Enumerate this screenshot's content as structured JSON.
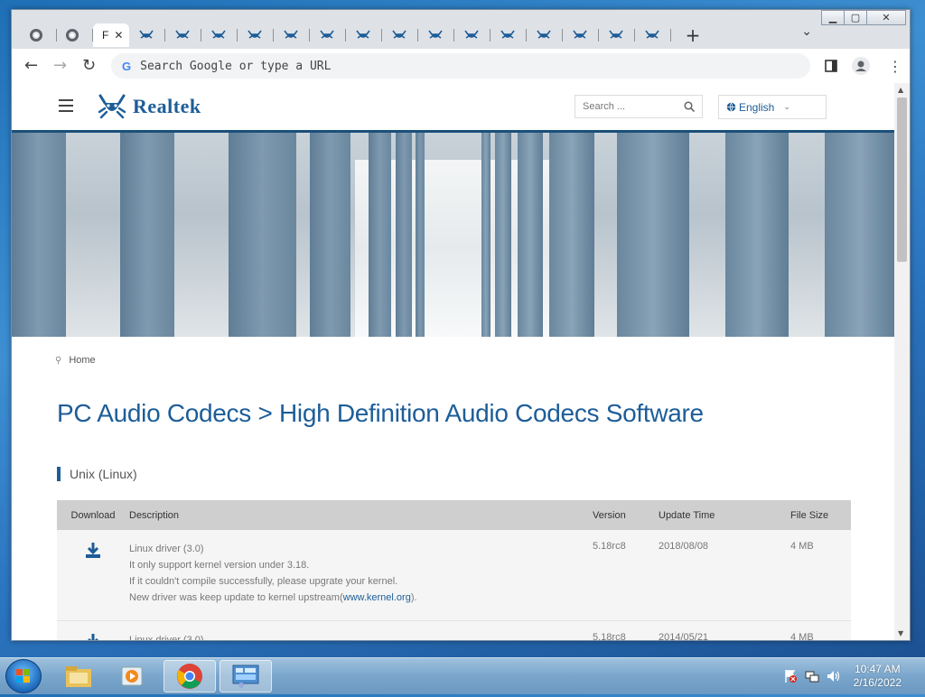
{
  "browser": {
    "tabs": [
      {
        "icon": "chrome-icon",
        "label": ""
      },
      {
        "icon": "chrome-icon",
        "label": ""
      },
      {
        "icon": "",
        "label": "F",
        "active": true
      },
      {
        "icon": "realtek-crab-icon",
        "label": ""
      },
      {
        "icon": "realtek-crab-icon",
        "label": ""
      },
      {
        "icon": "realtek-crab-icon",
        "label": ""
      },
      {
        "icon": "realtek-crab-icon",
        "label": ""
      },
      {
        "icon": "realtek-crab-icon",
        "label": ""
      },
      {
        "icon": "realtek-crab-icon",
        "label": ""
      },
      {
        "icon": "realtek-crab-icon",
        "label": ""
      },
      {
        "icon": "realtek-crab-icon",
        "label": ""
      },
      {
        "icon": "realtek-crab-icon",
        "label": ""
      },
      {
        "icon": "realtek-crab-icon",
        "label": ""
      },
      {
        "icon": "realtek-crab-icon",
        "label": ""
      },
      {
        "icon": "realtek-crab-icon",
        "label": ""
      },
      {
        "icon": "realtek-crab-icon",
        "label": ""
      },
      {
        "icon": "realtek-crab-icon",
        "label": ""
      },
      {
        "icon": "realtek-crab-icon",
        "label": ""
      }
    ],
    "omnibox_placeholder": "Search Google or type a URL",
    "google_letter": "G"
  },
  "site": {
    "logo_text": "Realtek",
    "search_placeholder": "Search ...",
    "language": "English",
    "breadcrumb_home": "Home",
    "page_title": "PC Audio Codecs > High Definition Audio Codecs Software",
    "section_title": "Unix (Linux)",
    "brand_color": "#1d5d98"
  },
  "table": {
    "headers": {
      "download": "Download",
      "description": "Description",
      "version": "Version",
      "update_time": "Update Time",
      "file_size": "File Size"
    },
    "rows": [
      {
        "desc_title": "Linux driver (3.0)",
        "desc_line1": "It only support kernel version under 3.18.",
        "desc_line2": "If it couldn't compile successfully, please upgrate your kernel.",
        "desc_line3_prefix": "New driver was keep update to kernel upstream(",
        "desc_link": "www.kernel.org",
        "desc_line3_suffix": ").",
        "version": "5.18rc8",
        "update_time": "2018/08/08",
        "file_size": "4 MB"
      },
      {
        "desc_title": "Linux driver (3.0)",
        "version": "5.18rc8",
        "update_time": "2014/05/21",
        "file_size": "4 MB"
      }
    ]
  },
  "taskbar": {
    "time": "10:47 AM",
    "date": "2/16/2022"
  }
}
